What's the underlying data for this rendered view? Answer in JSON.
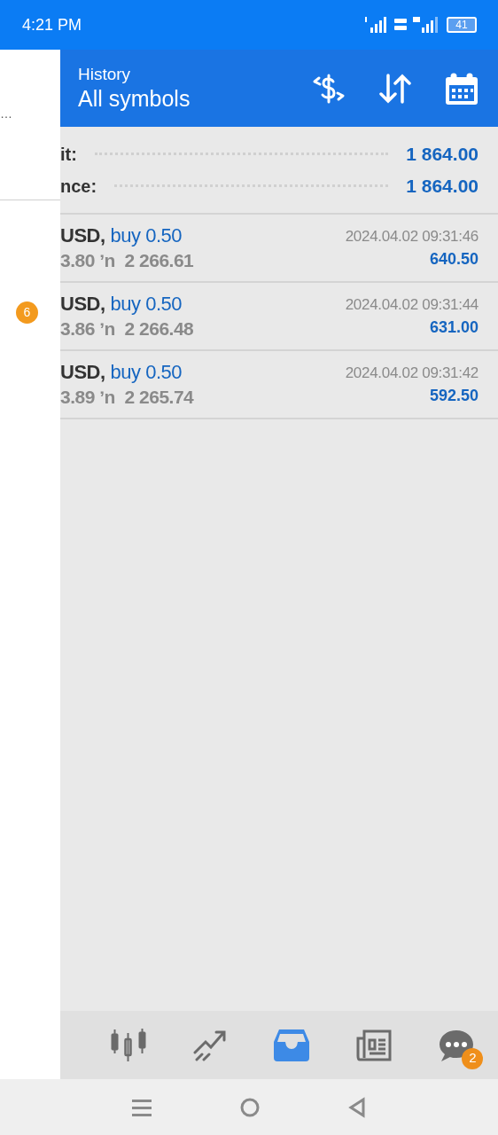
{
  "status_bar": {
    "time": "4:21 PM",
    "battery": "41"
  },
  "drawer": {
    "text": "…",
    "badge": "6"
  },
  "header": {
    "title": "History",
    "subtitle": "All symbols"
  },
  "summary": [
    {
      "label": "it:",
      "value": "1 864.00"
    },
    {
      "label": "nce:",
      "value": "1 864.00"
    }
  ],
  "deals": [
    {
      "symbol": "USD,",
      "type": "buy 0.50",
      "prices": "3.80 ʼn  2 266.61",
      "time": "2024.04.02 09:31:46",
      "profit": "640.50"
    },
    {
      "symbol": "USD,",
      "type": "buy 0.50",
      "prices": "3.86 ʼn  2 266.48",
      "time": "2024.04.02 09:31:44",
      "profit": "631.00"
    },
    {
      "symbol": "USD,",
      "type": "buy 0.50",
      "prices": "3.89 ʼn  2 265.74",
      "time": "2024.04.02 09:31:42",
      "profit": "592.50"
    }
  ],
  "bottom_nav": [
    {
      "kind": "chart",
      "selected": false
    },
    {
      "kind": "trade",
      "selected": false
    },
    {
      "kind": "history",
      "selected": true
    },
    {
      "kind": "news",
      "selected": false
    },
    {
      "kind": "chat",
      "selected": false,
      "badge": "2"
    }
  ]
}
